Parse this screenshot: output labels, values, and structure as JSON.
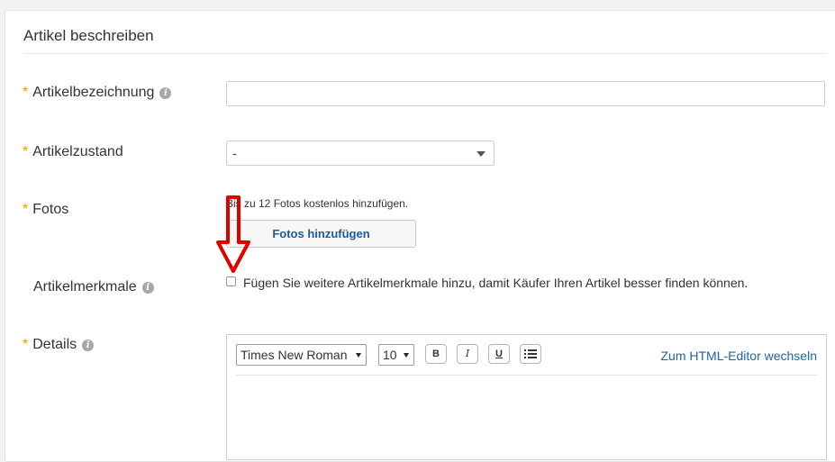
{
  "section": {
    "title": "Artikel beschreiben"
  },
  "required_mark": "*",
  "fields": {
    "title": {
      "label": "Artikelbezeichnung",
      "value": ""
    },
    "condition": {
      "label": "Artikelzustand",
      "selected": "-"
    },
    "photos": {
      "label": "Fotos",
      "hint": "Bis zu 12 Fotos kostenlos hinzufügen.",
      "button_label": "Fotos hinzufügen"
    },
    "item_specifics": {
      "label": "Artikelmerkmale",
      "checkbox_label": "Fügen Sie weitere Artikelmerkmale hinzu, damit Käufer Ihren Artikel besser finden können.",
      "checked": false
    },
    "details": {
      "label": "Details",
      "font": "Times New Roman",
      "font_size": "10",
      "bold": "B",
      "italic": "I",
      "underline": "U",
      "html_link": "Zum HTML-Editor wechseln"
    }
  },
  "icons": {
    "info": "info-icon",
    "list": "list-icon",
    "arrow": "red-down-arrow"
  },
  "colors": {
    "required": "#e89b12",
    "link": "#1d64b0",
    "button_text": "#1d5a9a",
    "arrow": "#e00000"
  }
}
